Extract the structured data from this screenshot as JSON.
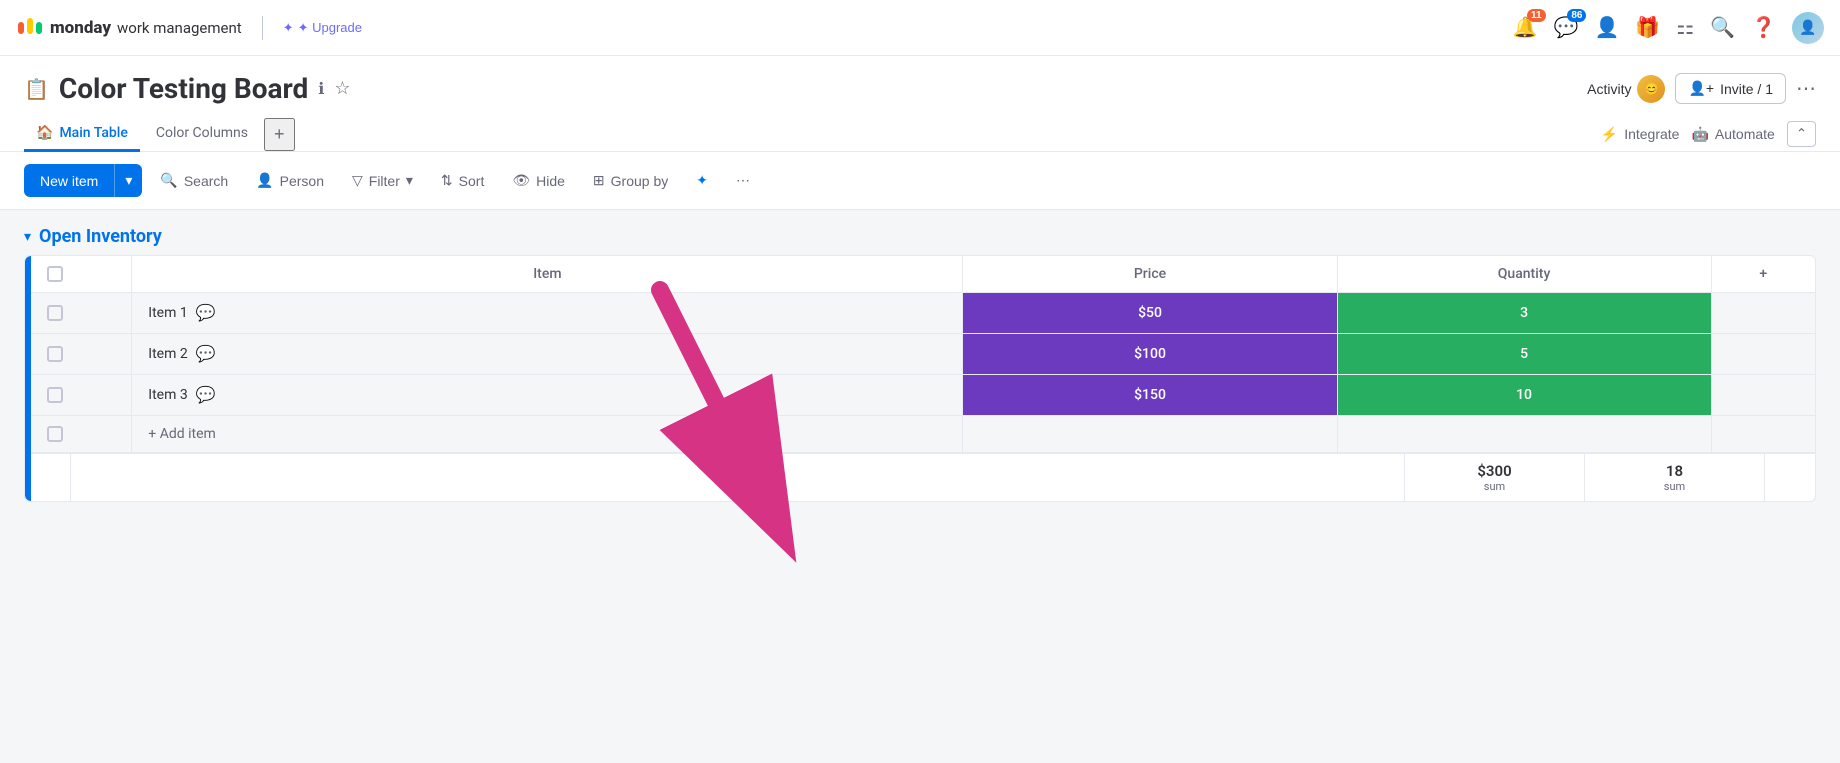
{
  "topbar": {
    "brand": "monday",
    "brand_suffix": " work management",
    "upgrade_label": "✦ Upgrade",
    "notification_count": "11",
    "inbox_count": "86",
    "icons": [
      "bell",
      "inbox",
      "person-add",
      "gift",
      "grid",
      "search",
      "question",
      "app-icon",
      "avatar"
    ]
  },
  "header": {
    "board_icon": "📋",
    "title": "Color Testing Board",
    "info_tooltip": "ℹ",
    "star_icon": "☆",
    "activity_label": "Activity",
    "invite_label": "Invite / 1",
    "more_icon": "⋯"
  },
  "tabs": {
    "items": [
      {
        "id": "main-table",
        "label": "Main Table",
        "active": true,
        "icon": "🏠"
      },
      {
        "id": "color-columns",
        "label": "Color Columns",
        "active": false,
        "icon": ""
      }
    ],
    "add_label": "+",
    "integrate_label": "Integrate",
    "automate_label": "Automate",
    "collapse_icon": "⌃"
  },
  "toolbar": {
    "new_item_label": "New item",
    "new_item_arrow": "▾",
    "search_label": "Search",
    "person_label": "Person",
    "filter_label": "Filter",
    "sort_label": "Sort",
    "hide_label": "Hide",
    "group_by_label": "Group by",
    "ai_icon": "✦",
    "more_icon": "⋯"
  },
  "table": {
    "group_title": "Open Inventory",
    "columns": [
      {
        "id": "item",
        "label": "Item"
      },
      {
        "id": "price",
        "label": "Price"
      },
      {
        "id": "quantity",
        "label": "Quantity"
      },
      {
        "id": "add",
        "label": "+"
      }
    ],
    "rows": [
      {
        "id": 1,
        "name": "Item 1",
        "price": "$50",
        "quantity": "3"
      },
      {
        "id": 2,
        "name": "Item 2",
        "price": "$100",
        "quantity": "5"
      },
      {
        "id": 3,
        "name": "Item 3",
        "price": "$150",
        "quantity": "10"
      }
    ],
    "add_item_label": "+ Add item",
    "sum_price": "$300",
    "sum_qty": "18",
    "sum_label": "sum"
  },
  "colors": {
    "primary": "#0073ea",
    "price_bg": "#6c3abe",
    "qty_bg": "#27ae60",
    "group_color": "#0073ea",
    "arrow_color": "#d63384"
  }
}
